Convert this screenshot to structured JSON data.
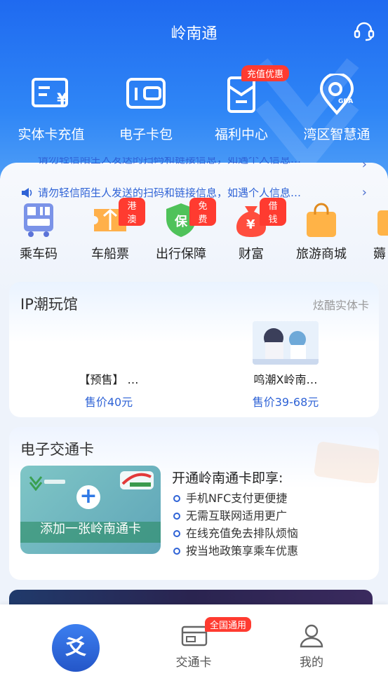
{
  "header": {
    "title": "岭南通"
  },
  "quick_actions": [
    {
      "label": "实体卡充值",
      "icon": "card-recharge-icon"
    },
    {
      "label": "电子卡包",
      "icon": "wallet-icon"
    },
    {
      "label": "福利中心",
      "icon": "gift-bag-icon",
      "badge": "充值优惠"
    },
    {
      "label": "湾区智慧通",
      "icon": "gba-location-icon"
    }
  ],
  "notices": [
    {
      "text": "请勿轻信陌生人发送的扫码和链接信息，如遇个人信息…"
    },
    {
      "text": "请勿轻信陌生人发送的扫码和链接信息，如遇个人信息…"
    }
  ],
  "services": [
    {
      "label": "乘车码",
      "icon": "bus-qr-icon"
    },
    {
      "label": "车船票",
      "icon": "ticket-icon",
      "badge": "港澳"
    },
    {
      "label": "出行保障",
      "icon": "shield-icon",
      "badge": "免费",
      "icon_text": "保"
    },
    {
      "label": "财富",
      "icon": "money-bag-icon",
      "badge": "借钱",
      "icon_text": "¥"
    },
    {
      "label": "旅游商城",
      "icon": "shopping-bag-icon"
    },
    {
      "label": "薅",
      "icon": "more-icon"
    }
  ],
  "ip_section": {
    "title": "IP潮玩馆",
    "more": "炫酷实体卡",
    "products": [
      {
        "name": "【预售】 …",
        "price": "售价40元"
      },
      {
        "name": "鸣潮X岭南…",
        "price": "售价39-68元"
      }
    ]
  },
  "etc_section": {
    "title": "电子交通卡",
    "add_card": "添加一张岭南通卡",
    "benefits_title": "开通岭南通卡即享:",
    "benefits": [
      "手机NFC支付更便捷",
      "无需互联网适用更广",
      "在线充值免去排队烦恼",
      "按当地政策享乘车优惠"
    ]
  },
  "tabbar": {
    "home_glyph": "爻",
    "items": [
      {
        "label": "交通卡",
        "badge": "全国通用"
      },
      {
        "label": "我的"
      }
    ]
  },
  "colors": {
    "primary": "#2f7bf0",
    "badge": "#ff3b30",
    "link": "#2f63d6"
  }
}
